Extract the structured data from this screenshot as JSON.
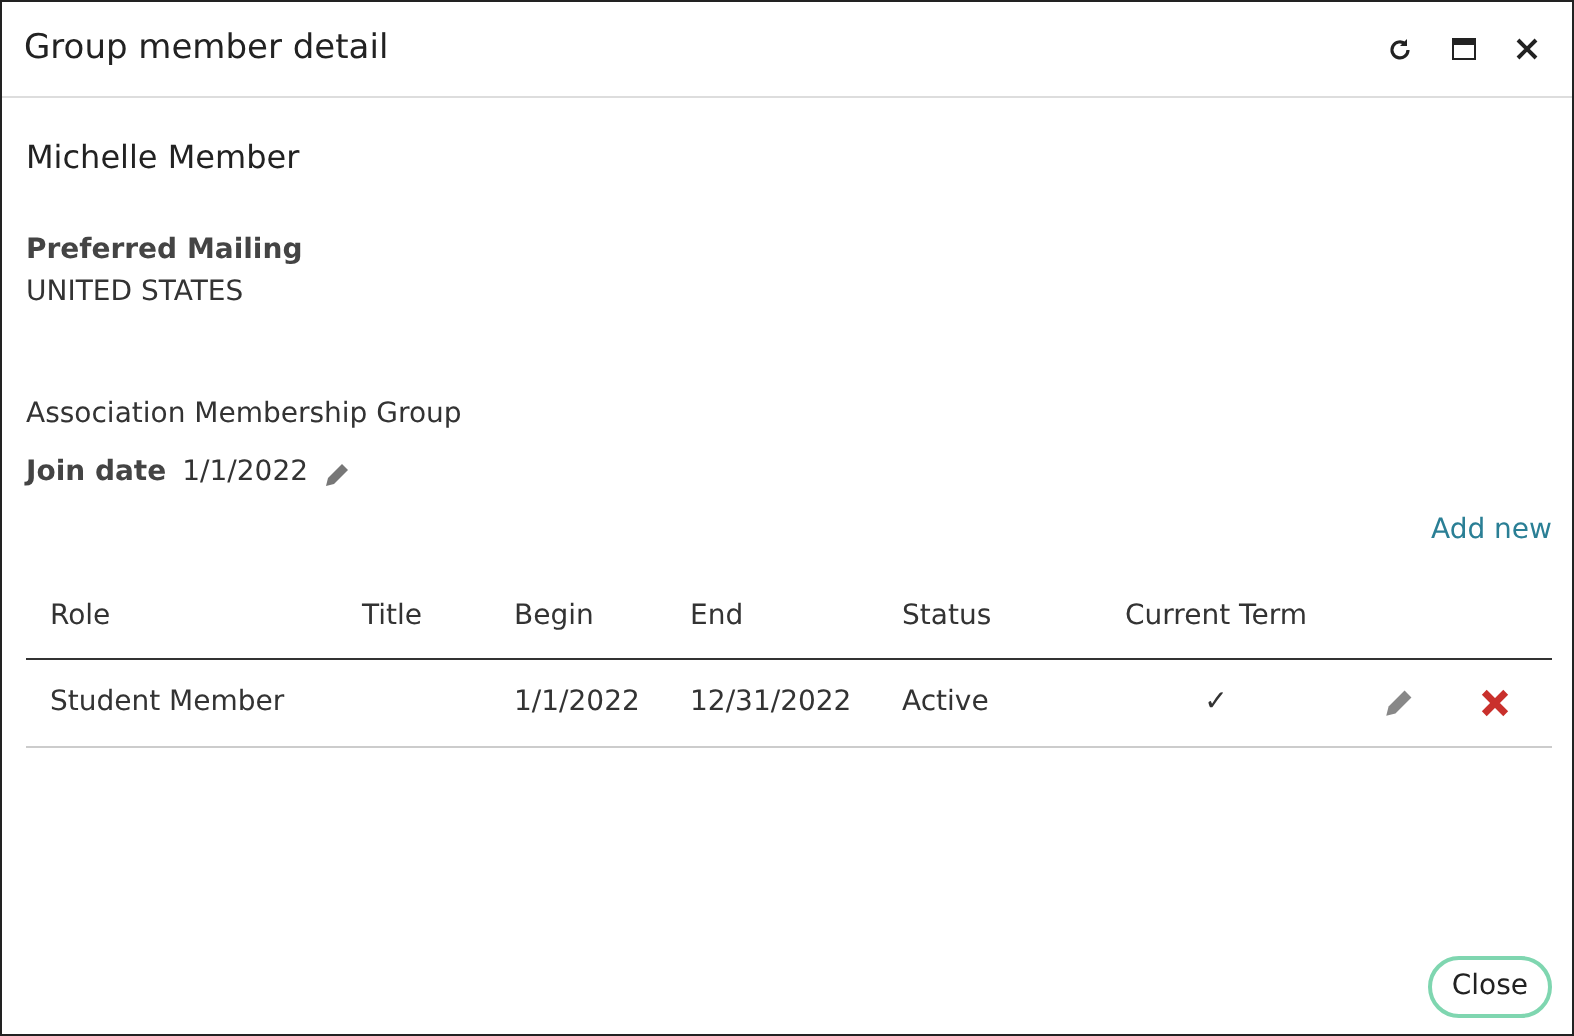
{
  "window": {
    "title": "Group member detail"
  },
  "member": {
    "name": "Michelle Member",
    "mailing_label": "Preferred Mailing",
    "mailing_value": "UNITED STATES"
  },
  "group": {
    "name": "Association Membership Group",
    "join_label": "Join date",
    "join_value": "1/1/2022"
  },
  "add_link": "Add new",
  "table": {
    "columns": [
      "Role",
      "Title",
      "Begin",
      "End",
      "Status",
      "Current Term"
    ],
    "rows": [
      {
        "cells": [
          "Student Member",
          "",
          "1/1/2022",
          "12/31/2022",
          "Active",
          "✓"
        ]
      }
    ]
  },
  "buttons": [
    "Close"
  ]
}
